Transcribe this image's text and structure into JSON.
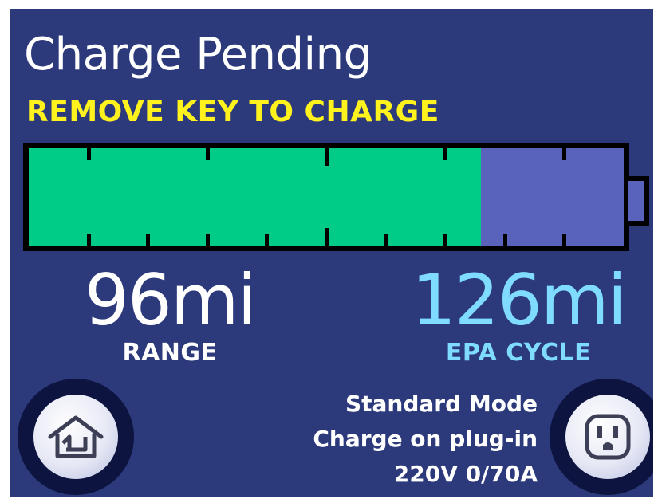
{
  "header": {
    "title": "Charge Pending",
    "warning": "REMOVE KEY TO CHARGE"
  },
  "battery": {
    "charge_fraction": 0.76,
    "colors": {
      "charged": "#00cc88",
      "remaining": "#5a63bc",
      "outline": "#000000"
    }
  },
  "range": {
    "value": "96mi",
    "label": "RANGE"
  },
  "epa": {
    "value": "126mi",
    "label": "EPA CYCLE"
  },
  "status": {
    "mode": "Standard Mode",
    "schedule": "Charge on plug-in",
    "power": "220V 0/70A"
  },
  "buttons": {
    "home_icon": "home-icon",
    "outlet_icon": "power-outlet-icon"
  },
  "colors": {
    "background": "#2c3a7c",
    "warning": "#fff21d",
    "epa_text": "#7fdcff"
  }
}
